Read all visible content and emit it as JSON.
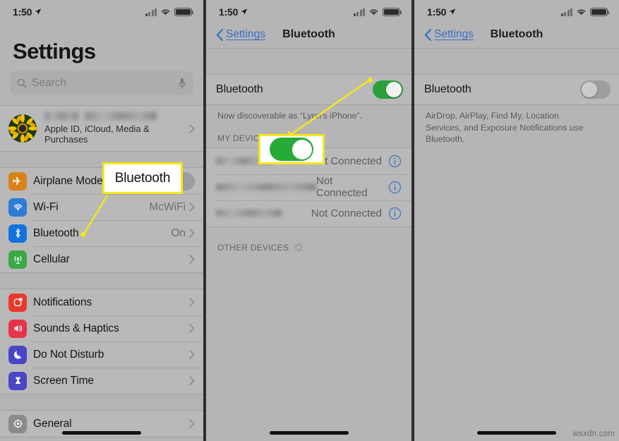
{
  "watermark": "wsxdn.com",
  "status_bar": {
    "time": "1:50",
    "location_icon": "location-arrow-icon",
    "signal_icon": "cellular-bars-icon",
    "wifi_icon": "wifi-icon",
    "battery_icon": "battery-icon"
  },
  "annotations": {
    "callout_bluetooth_label": "Bluetooth",
    "callout_color": "#f5e71a",
    "callout_toggle_state": "on"
  },
  "panel_settings": {
    "title": "Settings",
    "search": {
      "placeholder": "Search",
      "search_icon": "magnifier-icon",
      "mic_icon": "microphone-icon"
    },
    "profile": {
      "subtitle": "Apple ID, iCloud, Media & Purchases",
      "avatar_icon": "sunflower-avatar",
      "name_redacted": true
    },
    "group_connectivity": [
      {
        "label": "Airplane Mode",
        "icon": "airplane-icon",
        "icon_color": "#d9821a",
        "control": "toggle",
        "toggle_state": "off"
      },
      {
        "label": "Wi-Fi",
        "icon": "wifi-icon",
        "icon_color": "#2f7cd6",
        "control": "value",
        "value": "McWiFi"
      },
      {
        "label": "Bluetooth",
        "icon": "bluetooth-icon",
        "icon_color": "#1372e0",
        "control": "value",
        "value": "On"
      },
      {
        "label": "Cellular",
        "icon": "cellular-antenna-icon",
        "icon_color": "#3ca845",
        "control": "value",
        "value": ""
      }
    ],
    "group_alerts": [
      {
        "label": "Notifications",
        "icon": "notifications-icon",
        "icon_color": "#e8392c"
      },
      {
        "label": "Sounds & Haptics",
        "icon": "speaker-icon",
        "icon_color": "#e6334a"
      },
      {
        "label": "Do Not Disturb",
        "icon": "moon-icon",
        "icon_color": "#4a46c8"
      },
      {
        "label": "Screen Time",
        "icon": "hourglass-icon",
        "icon_color": "#4a46c8"
      }
    ],
    "group_system": [
      {
        "label": "General",
        "icon": "gear-icon",
        "icon_color": "#8b8b8b"
      }
    ]
  },
  "panel_bt_on": {
    "nav": {
      "back_label": "Settings",
      "back_icon": "chevron-left-icon",
      "title": "Bluetooth"
    },
    "bluetooth_row": {
      "label": "Bluetooth",
      "toggle_state": "on"
    },
    "footnote": "Now discoverable as “Lynn’s iPhone”.",
    "my_devices_header": "MY DEVICES",
    "devices": [
      {
        "name_redacted": true,
        "status": "Not Connected",
        "info_icon": "info-circle-icon"
      },
      {
        "name_redacted": true,
        "status": "Not Connected",
        "info_icon": "info-circle-icon"
      },
      {
        "name_redacted": true,
        "status": "Not Connected",
        "info_icon": "info-circle-icon"
      }
    ],
    "other_devices_header": "OTHER DEVICES",
    "other_devices_spinner": "activity-spinner-icon"
  },
  "panel_bt_off": {
    "nav": {
      "back_label": "Settings",
      "back_icon": "chevron-left-icon",
      "title": "Bluetooth"
    },
    "bluetooth_row": {
      "label": "Bluetooth",
      "toggle_state": "off"
    },
    "footnote": "AirDrop, AirPlay, Find My, Location Services, and Exposure Notifications use Bluetooth."
  }
}
